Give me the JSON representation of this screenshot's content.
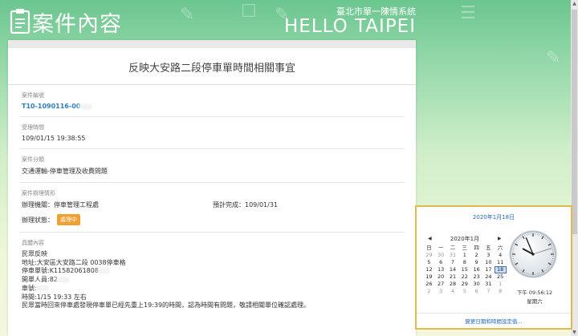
{
  "header": {
    "title": "案件內容",
    "subtitle": "臺北市單一陳情系統",
    "brand": "HELLO TAIPEI"
  },
  "case": {
    "heading": "反映大安路二段停車單時間相關事宜",
    "number_label": "案件編號",
    "number_value": "T10-1090116-00",
    "accepted_label": "受理時間",
    "accepted_value": "109/01/15 19:38:55",
    "category_label": "案件分類",
    "category_value": "交通運輸-停車管理及收費問題",
    "handling_label": "案件辦理情形",
    "agency": "辦理機關：停車管理工程處",
    "expected": "預計完成：109/01/31",
    "status_label": "辦理狀態：",
    "status_value": "處理中",
    "detail_label": "具體內容",
    "detail_lines": [
      "民眾反映",
      "地址:大安區大安路二段 0038停車格",
      "停車單號:K11582061808",
      "開單人員:82",
      "車號:",
      "時間:1/15 19:33 左右",
      "民眾當時回來停車處發現停車單已經先重上19:39的時間，認為時間有問題，敬請相關單位確認處理。"
    ]
  },
  "clock_popup": {
    "date_title": "2020年1月18日",
    "month_label": "2020年1月",
    "prev": "◀",
    "next": "▶",
    "weekdays": [
      "日",
      "一",
      "二",
      "三",
      "四",
      "五",
      "六"
    ],
    "weeks": [
      [
        "29",
        "30",
        "31",
        "1",
        "2",
        "3",
        "4"
      ],
      [
        "5",
        "6",
        "7",
        "8",
        "9",
        "10",
        "11"
      ],
      [
        "12",
        "13",
        "14",
        "15",
        "16",
        "17",
        "18"
      ],
      [
        "19",
        "20",
        "21",
        "22",
        "23",
        "24",
        "25"
      ],
      [
        "26",
        "27",
        "28",
        "29",
        "30",
        "31",
        "1"
      ],
      [
        "2",
        "3",
        "4",
        "5",
        "6",
        "7",
        "8"
      ]
    ],
    "time": "下午 09:56:12",
    "day_name": "星期六",
    "footer_link": "變更日期和時間設定值...",
    "clock": {
      "hours": 9,
      "minutes": 56,
      "seconds": 12
    }
  },
  "colors": {
    "accent_link": "#2a7fc9",
    "badge": "#f0a030",
    "popup_border": "#e2b94f"
  }
}
